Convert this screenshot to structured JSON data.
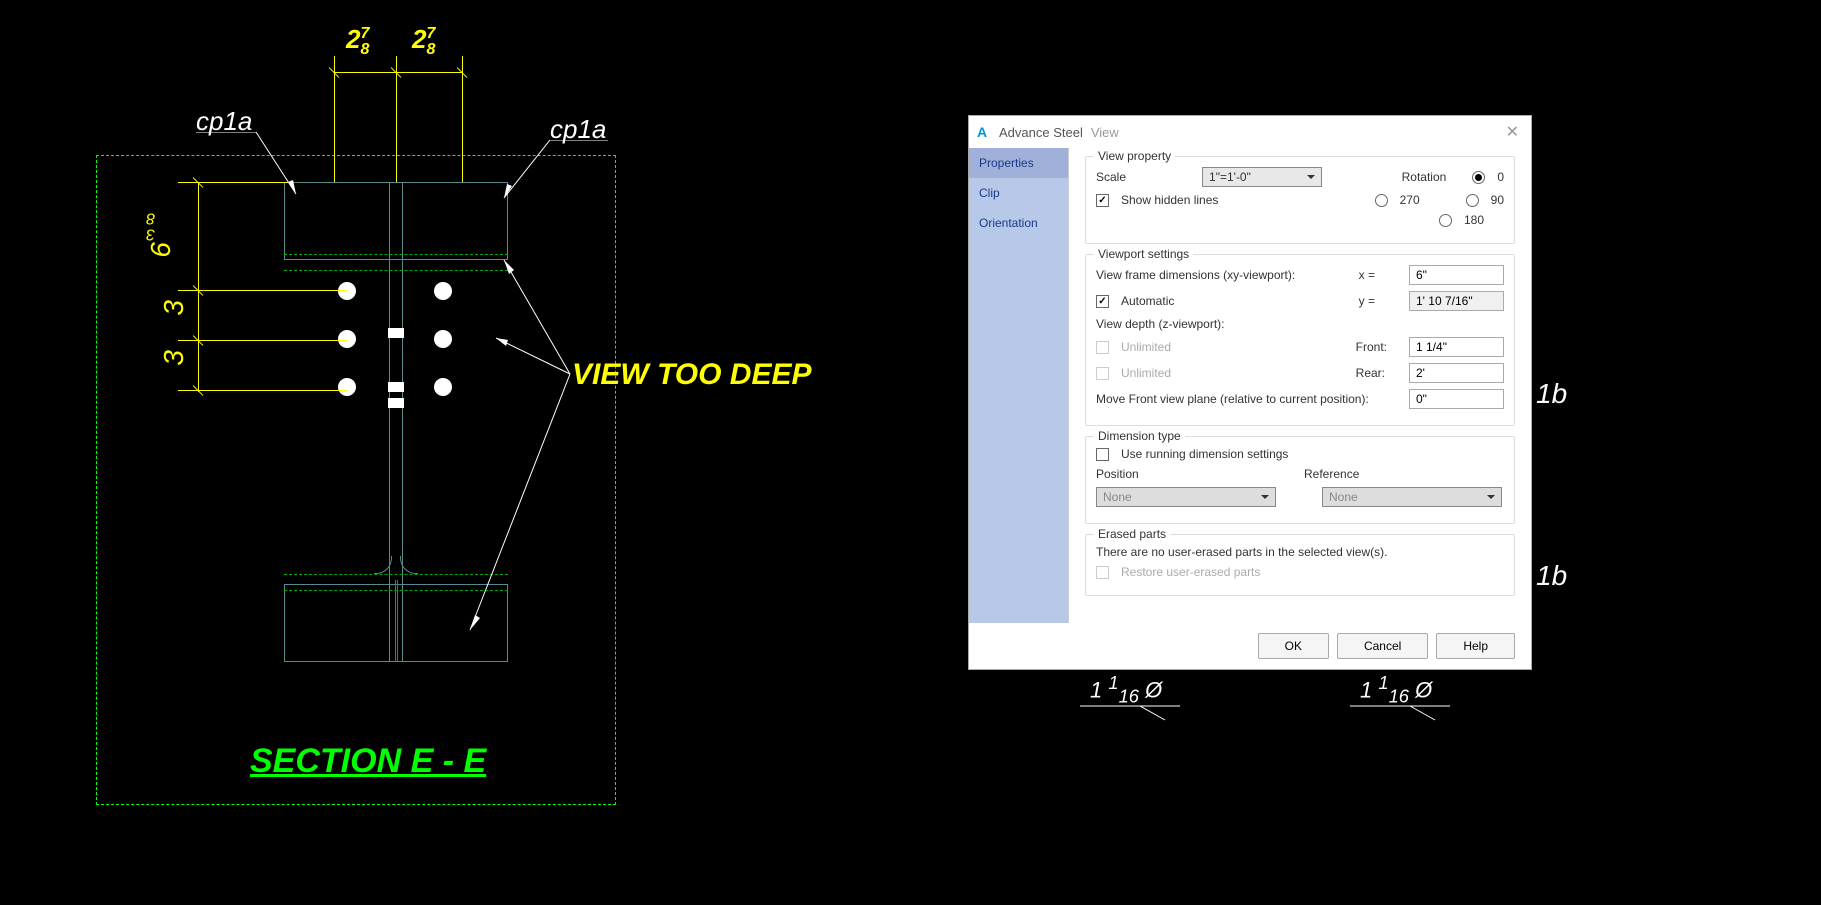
{
  "cad": {
    "section_title": "SECTION E - E",
    "annotation": "VIEW TOO DEEP",
    "cp_label_left": "cp1a",
    "cp_label_right": "cp1a",
    "dim_top_left_whole": "2",
    "dim_top_left_num": "7",
    "dim_top_left_den": "8",
    "dim_top_right_whole": "2",
    "dim_top_right_num": "7",
    "dim_top_right_den": "8",
    "dim_v_top_whole": "6",
    "dim_v_top_num": "3",
    "dim_v_top_den": "8",
    "dim_v_mid": "3",
    "dim_v_bot": "3",
    "bg_dim1_whole": "1",
    "bg_dim1_num": "1",
    "bg_dim1_den": "16",
    "bg_dim1_sym": "Ø",
    "bg_dim2_whole": "1",
    "bg_dim2_num": "1",
    "bg_dim2_den": "16",
    "bg_dim2_sym": "Ø",
    "bg_label1": "1b",
    "bg_label2": "1b"
  },
  "dialog": {
    "app_name": "Advance Steel",
    "sub_title": "View",
    "sidebar": {
      "properties": "Properties",
      "clip": "Clip",
      "orientation": "Orientation"
    },
    "groups": {
      "view_property": "View property",
      "viewport_settings": "Viewport settings",
      "dimension_type": "Dimension type",
      "erased_parts": "Erased parts"
    },
    "labels": {
      "scale": "Scale",
      "rotation": "Rotation",
      "show_hidden": "Show hidden lines",
      "rot0": "0",
      "rot270": "270",
      "rot90": "90",
      "rot180": "180",
      "vf_dims": "View frame dimensions (xy-viewport):",
      "automatic": "Automatic",
      "x": "x =",
      "y": "y =",
      "view_depth": "View depth (z-viewport):",
      "unlimited": "Unlimited",
      "front": "Front:",
      "rear": "Rear:",
      "move_front": "Move Front view plane (relative to current position):",
      "use_running": "Use running dimension settings",
      "position": "Position",
      "reference": "Reference",
      "none": "None",
      "erased_msg": "There are no user-erased parts in the selected view(s).",
      "restore": "Restore user-erased parts"
    },
    "values": {
      "scale": "1\"=1'-0\"",
      "x": "6\"",
      "y": "1' 10 7/16\"",
      "front": "1 1/4\"",
      "rear": "2'",
      "move": "0\""
    },
    "buttons": {
      "ok": "OK",
      "cancel": "Cancel",
      "help": "Help"
    }
  }
}
